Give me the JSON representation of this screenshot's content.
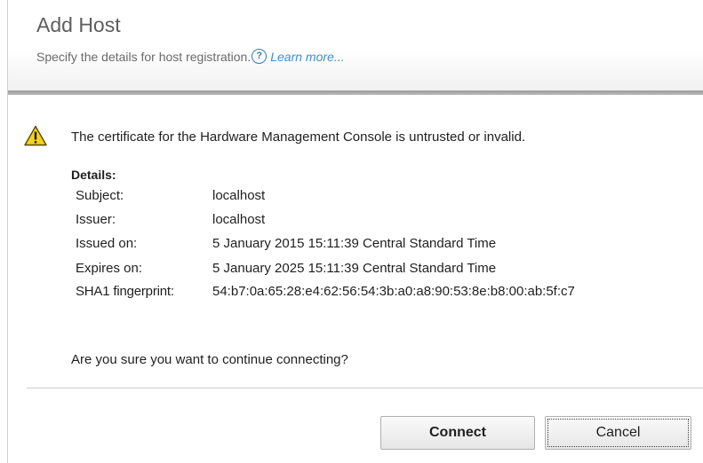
{
  "dialog": {
    "title": "Add Host",
    "subtitle": "Specify the details for host registration.",
    "help_icon": "question-circle-icon",
    "learn_more_label": "Learn more..."
  },
  "warning": {
    "icon": "warning-triangle-icon",
    "message": "The certificate for the Hardware Management Console is untrusted or invalid."
  },
  "details": {
    "heading": "Details:",
    "rows": [
      {
        "label": "Subject:",
        "value": "localhost"
      },
      {
        "label": "Issuer:",
        "value": "localhost"
      },
      {
        "label": "Issued on:",
        "value": "5 January 2015 15:11:39 Central Standard Time"
      },
      {
        "label": "Expires on:",
        "value": "5 January 2025 15:11:39 Central Standard Time"
      },
      {
        "label": "SHA1 fingerprint:",
        "value": "54:b7:0a:65:28:e4:62:56:54:3b:a0:a8:90:53:8e:b8:00:ab:5f:c7"
      }
    ]
  },
  "question": "Are you sure you want to continue connecting?",
  "buttons": {
    "connect": "Connect",
    "cancel": "Cancel"
  },
  "colors": {
    "link": "#3f8ed3",
    "warning_fill": "#f5d21b",
    "header_rule": "#9a9a9a"
  }
}
